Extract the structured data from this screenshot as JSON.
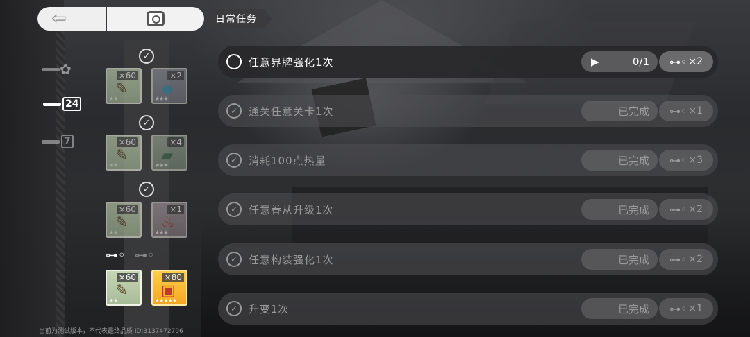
{
  "topbar": {
    "back_icon": "arrow-left-icon",
    "camera_icon": "camera-icon",
    "tab_label": "日常任务"
  },
  "sidebar": {
    "items": [
      {
        "icon": "paw-icon",
        "badge": ""
      },
      {
        "icon": "key-icon",
        "badge": "24"
      },
      {
        "icon": "key-icon",
        "badge": "7"
      }
    ]
  },
  "rewards": {
    "tiers": [
      {
        "items": [
          {
            "qty": "×60",
            "kind": "paper"
          },
          {
            "qty": "×2",
            "kind": "crystal"
          }
        ],
        "claimed": true
      },
      {
        "items": [
          {
            "qty": "×60",
            "kind": "paper"
          },
          {
            "qty": "×4",
            "kind": "module"
          }
        ],
        "claimed": true
      },
      {
        "items": [
          {
            "qty": "×60",
            "kind": "paper"
          },
          {
            "qty": "×1",
            "kind": "pepper"
          }
        ],
        "claimed": true
      },
      {
        "items": [
          {
            "qty": "×60",
            "kind": "paper"
          },
          {
            "qty": "×80",
            "kind": "chest"
          }
        ],
        "claimed": false
      }
    ]
  },
  "tasks": [
    {
      "name": "任意界牌强化1次",
      "progress": "0/1",
      "reward": "×2",
      "done": false
    },
    {
      "name": "通关任意关卡1次",
      "progress": "已完成",
      "reward": "×1",
      "done": true
    },
    {
      "name": "消耗100点热量",
      "progress": "已完成",
      "reward": "×3",
      "done": true
    },
    {
      "name": "任意眷从升级1次",
      "progress": "已完成",
      "reward": "×2",
      "done": true
    },
    {
      "name": "任意构装强化1次",
      "progress": "已完成",
      "reward": "×2",
      "done": true
    },
    {
      "name": "升变1次",
      "progress": "已完成",
      "reward": "×1",
      "done": true
    }
  ],
  "footer": {
    "note": "当前为测试版本，不代表最终品质 ID:3137472796"
  }
}
